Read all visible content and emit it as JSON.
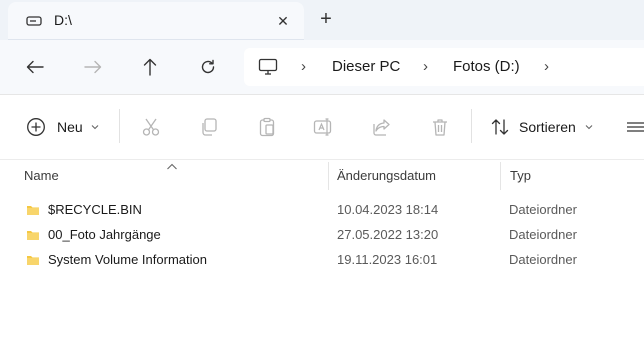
{
  "tab": {
    "title": "D:\\",
    "close_glyph": "✕",
    "new_glyph": "+"
  },
  "nav": {
    "back_icon": "back-arrow-icon",
    "forward_icon": "forward-arrow-icon",
    "up_icon": "up-arrow-icon",
    "refresh_icon": "refresh-icon"
  },
  "address": {
    "crumbs": [
      "Dieser PC",
      "Fotos (D:)"
    ],
    "separator": "›"
  },
  "toolbar": {
    "new_label": "Neu",
    "sort_label": "Sortieren"
  },
  "columns": {
    "name": "Name",
    "date": "Änderungsdatum",
    "type": "Typ"
  },
  "files": [
    {
      "name": "$RECYCLE.BIN",
      "date": "10.04.2023 18:14",
      "type": "Dateiordner"
    },
    {
      "name": "00_Foto Jahrgänge",
      "date": "27.05.2022 13:20",
      "type": "Dateiordner"
    },
    {
      "name": "System Volume Information",
      "date": "19.11.2023 16:01",
      "type": "Dateiordner"
    }
  ],
  "colors": {
    "folder": "#f5c842",
    "accent": "#0067c0",
    "icon_disabled": "#b5b5b5"
  }
}
